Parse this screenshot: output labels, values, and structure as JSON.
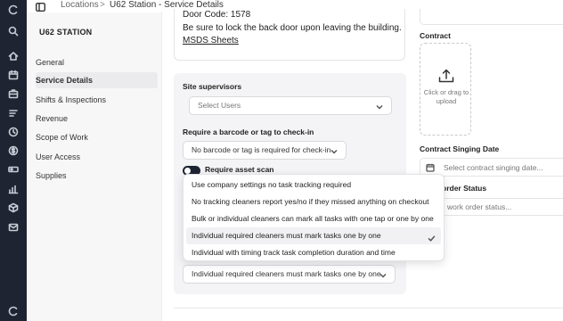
{
  "breadcrumb": {
    "items": [
      "Locations",
      "U62 Station - Service Details"
    ],
    "separator": ">"
  },
  "sidebar": {
    "title": "U62 STATION",
    "items": [
      {
        "label": "General",
        "active": false
      },
      {
        "label": "Service Details",
        "active": true
      },
      {
        "label": "Shifts & Inspections",
        "active": false
      },
      {
        "label": "Revenue",
        "active": false
      },
      {
        "label": "Scope of Work",
        "active": false
      },
      {
        "label": "User Access",
        "active": false
      },
      {
        "label": "Supplies",
        "active": false
      }
    ]
  },
  "rail_icons": [
    "app-logo-icon",
    "search-icon",
    "home-icon",
    "calendar-icon",
    "briefcase-icon",
    "list-icon",
    "clock-icon",
    "dollar-icon",
    "toggle-icon",
    "chart-icon",
    "box-icon",
    "mail-icon"
  ],
  "notes": {
    "line1": "Door Code: 1578",
    "line2": "Be sure to lock the back door upon leaving the building.",
    "link": "MSDS Sheets"
  },
  "site_supervisors": {
    "label": "Site supervisors",
    "placeholder": "Select Users"
  },
  "barcode": {
    "label": "Require a barcode or tag to check-in",
    "value": "No barcode or tag is required for check-in"
  },
  "asset_scan": {
    "label": "Require asset scan",
    "enabled": true
  },
  "task_tracking": {
    "value": "Individual required cleaners must mark tasks one by one",
    "options": [
      "Use company settings no task tracking required",
      "No tracking cleaners report yes/no if they missed anything on checkout",
      "Bulk or individual cleaners can mark all tasks with one tap or one by one",
      "Individual required cleaners must mark tasks one by one",
      "Individual with timing track task completion duration and time"
    ],
    "selected_index": 3
  },
  "contract": {
    "label": "Contract",
    "upload_text": "Click or drag to upload"
  },
  "contract_signing": {
    "label": "Contract Singing Date",
    "placeholder": "Select contract singing date..."
  },
  "work_order": {
    "label": "order Status",
    "placeholder": "work order status..."
  },
  "colors": {
    "rail": "#1f2433",
    "sidebar_bg": "#f7f7f8",
    "card_bg": "#f4f4f6"
  }
}
